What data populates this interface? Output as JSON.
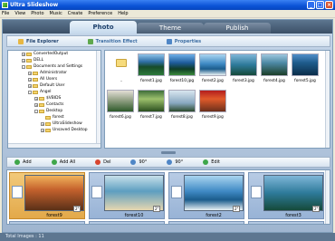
{
  "window": {
    "title": "Ultra Slideshow"
  },
  "menu": [
    "File",
    "View",
    "Photo",
    "Music",
    "Create",
    "Preference",
    "Help"
  ],
  "main_tabs": [
    "Photo",
    "Theme",
    "Publish"
  ],
  "sub_tabs": [
    "File Explorer",
    "Transition Effect",
    "Properties"
  ],
  "tree": [
    {
      "label": "ConvertedOutput",
      "indent": 0
    },
    {
      "label": "DELL",
      "indent": 0
    },
    {
      "label": "Documents and Settings",
      "indent": 0
    },
    {
      "label": "Administrator",
      "indent": 1
    },
    {
      "label": "All Users",
      "indent": 1
    },
    {
      "label": "Default User",
      "indent": 1
    },
    {
      "label": "Angel",
      "indent": 1
    },
    {
      "label": "$VBIDS",
      "indent": 2
    },
    {
      "label": "Contacts",
      "indent": 2
    },
    {
      "label": "Desktop",
      "indent": 2
    },
    {
      "label": "forest",
      "indent": 3
    },
    {
      "label": "UltraSlideshow",
      "indent": 3
    },
    {
      "label": "Unsaved Desktop",
      "indent": 3
    }
  ],
  "files": {
    "row1": [
      "..",
      "forest1.jpg",
      "forest10.jpg",
      "forest2.jpg",
      "forest3.jpg",
      "forest4.jpg",
      "forest5.jpg"
    ],
    "row2": [
      "forest6.jpg",
      "forest7.jpg",
      "forest8.jpg",
      "forest9.jpg"
    ]
  },
  "toolbar": [
    "Add",
    "Add All",
    "Del",
    "90°",
    "90°",
    "Edit"
  ],
  "slides": [
    {
      "name": "forest9",
      "duration": "2\"",
      "selected": true
    },
    {
      "name": "forest10",
      "duration": "2\"",
      "selected": false
    },
    {
      "name": "forest2",
      "duration": "2\"",
      "selected": false
    },
    {
      "name": "forest3",
      "duration": "2\"",
      "selected": false
    }
  ],
  "status": {
    "text": "Total Images : 11"
  }
}
